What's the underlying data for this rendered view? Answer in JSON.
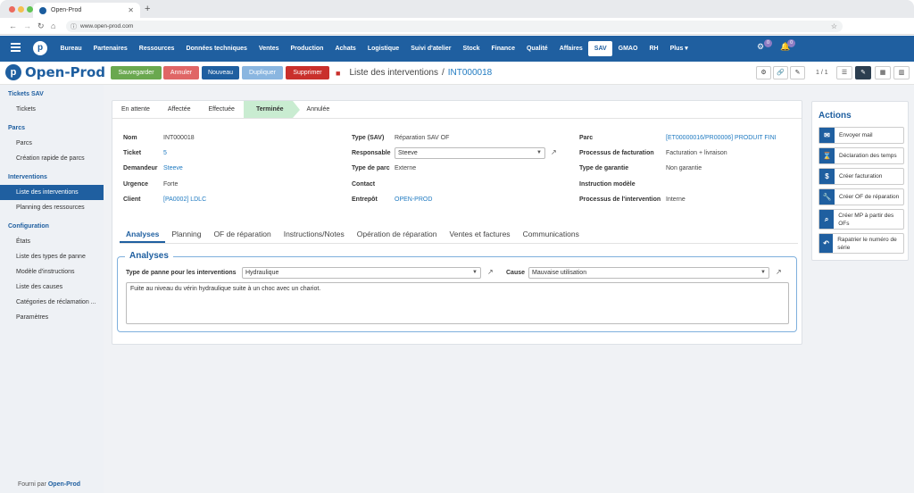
{
  "browser": {
    "tab_title": "Open-Prod",
    "url": "www.open-prod.com"
  },
  "topnav": {
    "items": [
      "Bureau",
      "Partenaires",
      "Ressources",
      "Données techniques",
      "Ventes",
      "Production",
      "Achats",
      "Logistique",
      "Suivi d'atelier",
      "Stock",
      "Finance",
      "Qualité",
      "Affaires",
      "SAV",
      "GMAO",
      "RH",
      "Plus ▾"
    ],
    "active": "SAV",
    "badge_activity": "0",
    "badge_notifications": "0"
  },
  "logo": {
    "mark": "p",
    "text": "Open-Prod"
  },
  "control": {
    "save": "Sauvegarder",
    "cancel": "Annuler",
    "new": "Nouveau",
    "duplicate": "Dupliquer",
    "delete": "Supprimer",
    "breadcrumb_parent": "Liste des interventions",
    "breadcrumb_sep": "/",
    "breadcrumb_current": "INT000018",
    "pager": "1 / 1",
    "colors": {
      "save": "#6aa84f",
      "cancel": "#e06666",
      "new": "#1f5fa0",
      "duplicate": "#8ab6e0",
      "delete": "#c9302c"
    }
  },
  "sidebar": {
    "sections": [
      {
        "title": "Tickets SAV",
        "items": [
          "Tickets"
        ]
      },
      {
        "title": "Parcs",
        "items": [
          "Parcs",
          "Création rapide de parcs"
        ]
      },
      {
        "title": "Interventions",
        "items": [
          "Liste des interventions",
          "Planning des ressources"
        ]
      },
      {
        "title": "Configuration",
        "items": [
          "États",
          "Liste des types de panne",
          "Modèle d'instructions",
          "Liste des causes",
          "Catégories de réclamation ...",
          "Paramètres"
        ]
      }
    ],
    "active_item": "Liste des interventions",
    "footer_prefix": "Fourni par",
    "footer_brand": "Open-Prod"
  },
  "statusbar": {
    "stages": [
      "En attente",
      "Affectée",
      "Effectuée",
      "Terminée",
      "Annulée"
    ],
    "current": "Terminée"
  },
  "form": {
    "col1": [
      {
        "label": "Nom",
        "value": "INT000018"
      },
      {
        "label": "Ticket",
        "value": "5"
      },
      {
        "label": "Demandeur",
        "value": "Steeve"
      },
      {
        "label": "Urgence",
        "value": "Forte"
      },
      {
        "label": "Client",
        "value": "[PA0002] LDLC"
      }
    ],
    "col2": [
      {
        "label": "Type (SAV)",
        "value": "Réparation SAV OF"
      },
      {
        "label": "Responsable",
        "value": "Steeve"
      },
      {
        "label": "Type de parc",
        "value": "Externe"
      },
      {
        "label": "Contact",
        "value": ""
      },
      {
        "label": "Entrepôt",
        "value": "OPEN-PROD"
      }
    ],
    "col3": [
      {
        "label": "Parc",
        "value": "[ET00000016/PR00006] PRODUIT FINI"
      },
      {
        "label": "Processus de facturation",
        "value": "Facturation + livraison"
      },
      {
        "label": "Type de garantie",
        "value": "Non garantie"
      },
      {
        "label": "Instruction modèle",
        "value": ""
      },
      {
        "label": "Processus de l'intervention",
        "value": "Interne"
      }
    ]
  },
  "tabs": [
    "Analyses",
    "Planning",
    "OF de réparation",
    "Instructions/Notes",
    "Opération de réparation",
    "Ventes et factures",
    "Communications"
  ],
  "active_tab": "Analyses",
  "analyses": {
    "legend": "Analyses",
    "panne_label": "Type de panne pour les interventions",
    "panne_value": "Hydraulique",
    "cause_label": "Cause",
    "cause_value": "Mauvaise utilisation",
    "note": "Fuite au niveau du vérin hydraulique suite à un choc avec un chariot."
  },
  "actions": {
    "title": "Actions",
    "items": [
      {
        "icon": "envelope-icon",
        "glyph": "✉",
        "label": "Envoyer mail"
      },
      {
        "icon": "hourglass-icon",
        "glyph": "⌛",
        "label": "Déclaration des temps"
      },
      {
        "icon": "dollar-icon",
        "glyph": "$",
        "label": "Créer facturation"
      },
      {
        "icon": "wrench-icon",
        "glyph": "🔧",
        "label": "Créer OF de réparation"
      },
      {
        "icon": "search-icon",
        "glyph": "⌕",
        "label": "Créer MP à partir des OFs"
      },
      {
        "icon": "undo-icon",
        "glyph": "↶",
        "label": "Rapatrier le numéro de série"
      }
    ]
  }
}
